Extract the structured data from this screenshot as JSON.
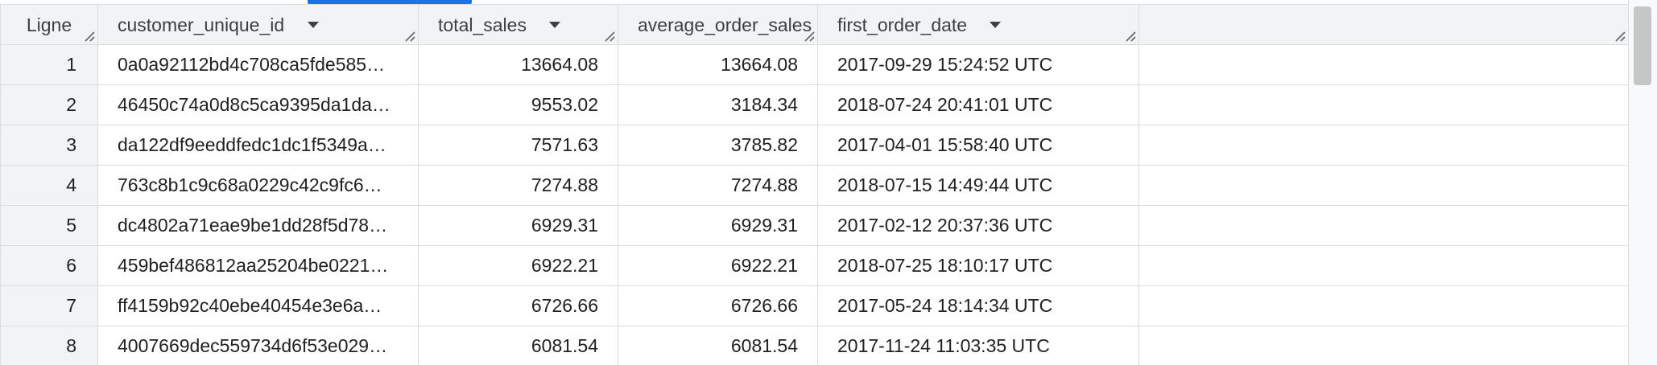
{
  "table": {
    "columns": {
      "row": "Ligne",
      "customer_unique_id": "customer_unique_id",
      "total_sales": "total_sales",
      "average_order_sales": "average_order_sales",
      "first_order_date": "first_order_date"
    },
    "rows": [
      {
        "num": "1",
        "customer_unique_id": "0a0a92112bd4c708ca5fde585…",
        "total_sales": "13664.08",
        "average_order_sales": "13664.08",
        "first_order_date": "2017-09-29 15:24:52 UTC"
      },
      {
        "num": "2",
        "customer_unique_id": "46450c74a0d8c5ca9395da1da…",
        "total_sales": "9553.02",
        "average_order_sales": "3184.34",
        "first_order_date": "2018-07-24 20:41:01 UTC"
      },
      {
        "num": "3",
        "customer_unique_id": "da122df9eeddfedc1dc1f5349a…",
        "total_sales": "7571.63",
        "average_order_sales": "3785.82",
        "first_order_date": "2017-04-01 15:58:40 UTC"
      },
      {
        "num": "4",
        "customer_unique_id": "763c8b1c9c68a0229c42c9fc6…",
        "total_sales": "7274.88",
        "average_order_sales": "7274.88",
        "first_order_date": "2018-07-15 14:49:44 UTC"
      },
      {
        "num": "5",
        "customer_unique_id": "dc4802a71eae9be1dd28f5d78…",
        "total_sales": "6929.31",
        "average_order_sales": "6929.31",
        "first_order_date": "2017-02-12 20:37:36 UTC"
      },
      {
        "num": "6",
        "customer_unique_id": "459bef486812aa25204be0221…",
        "total_sales": "6922.21",
        "average_order_sales": "6922.21",
        "first_order_date": "2018-07-25 18:10:17 UTC"
      },
      {
        "num": "7",
        "customer_unique_id": "ff4159b92c40ebe40454e3e6a…",
        "total_sales": "6726.66",
        "average_order_sales": "6726.66",
        "first_order_date": "2017-05-24 18:14:34 UTC"
      },
      {
        "num": "8",
        "customer_unique_id": "4007669dec559734d6f53e029…",
        "total_sales": "6081.54",
        "average_order_sales": "6081.54",
        "first_order_date": "2017-11-24 11:03:35 UTC"
      }
    ]
  },
  "icons": {
    "sort": "chevron-down-icon",
    "resize": "resize-handle-icon"
  },
  "colors": {
    "accent": "#1a73e8",
    "header_bg": "#f1f3f4",
    "grid": "#dadce0"
  }
}
